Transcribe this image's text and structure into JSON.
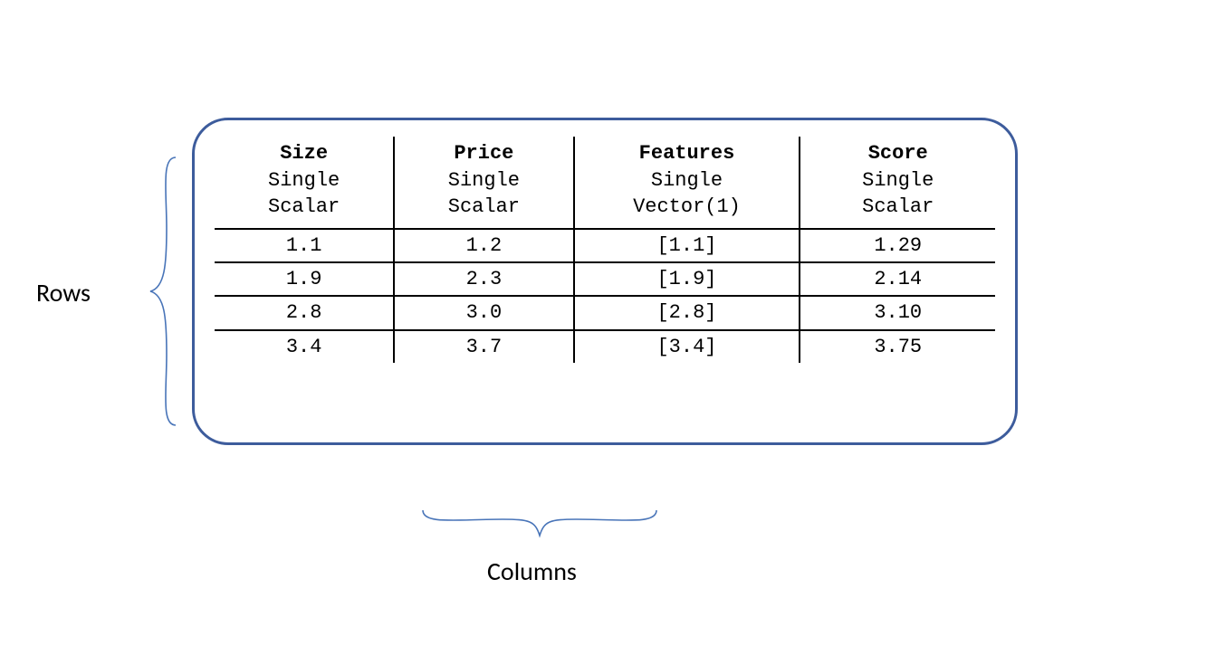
{
  "labels": {
    "rows": "Rows",
    "columns": "Columns"
  },
  "table": {
    "columns": [
      {
        "name": "Size",
        "card": "Single",
        "type": "Scalar"
      },
      {
        "name": "Price",
        "card": "Single",
        "type": "Scalar"
      },
      {
        "name": "Features",
        "card": "Single",
        "type": "Vector(1)"
      },
      {
        "name": "Score",
        "card": "Single",
        "type": "Scalar"
      }
    ],
    "rows": [
      {
        "size": "1.1",
        "price": "1.2",
        "features": "[1.1]",
        "score": "1.29"
      },
      {
        "size": "1.9",
        "price": "2.3",
        "features": "[1.9]",
        "score": "2.14"
      },
      {
        "size": "2.8",
        "price": "3.0",
        "features": "[2.8]",
        "score": "3.10"
      },
      {
        "size": "3.4",
        "price": "3.7",
        "features": "[3.4]",
        "score": "3.75"
      }
    ]
  }
}
